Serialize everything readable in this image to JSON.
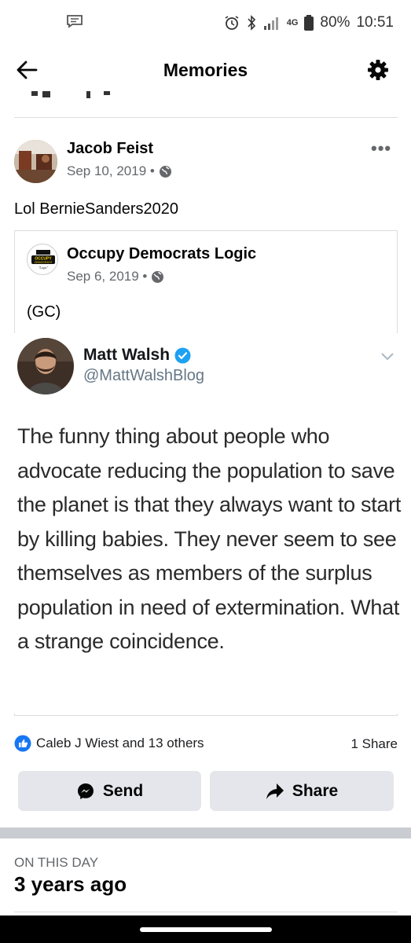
{
  "status_bar": {
    "battery": "80%",
    "time": "10:51",
    "network": "4G"
  },
  "header": {
    "title": "Memories"
  },
  "post": {
    "author": "Jacob Feist",
    "date": "Sep 10, 2019 •",
    "text": "Lol BernieSanders2020",
    "shared": {
      "page_name": "Occupy Democrats Logic",
      "page_logo_text": "OCCUPY DEMOCRATS",
      "page_logo_sub": "\"Logic\"",
      "date": "Sep 6, 2019 •",
      "text": "(GC)",
      "tweet": {
        "author": "Matt Walsh",
        "handle": "@MattWalshBlog",
        "verified_color": "#1da1f2",
        "text": "The funny thing about people who advocate reducing the population to save the planet is that they always want to start by killing babies. They never seem to see themselves as members of the surplus population in need of extermination. What a strange coincidence."
      }
    },
    "reactions": {
      "summary": "Caleb J Wiest and 13 others",
      "shares": "1 Share"
    },
    "actions": {
      "send_label": "Send",
      "share_label": "Share"
    }
  },
  "on_this_day": {
    "label": "ON THIS DAY",
    "ago": "3 years ago"
  },
  "colors": {
    "accent": "#1877f2",
    "secondary_text": "#65676b",
    "button_bg": "#e4e6eb"
  }
}
